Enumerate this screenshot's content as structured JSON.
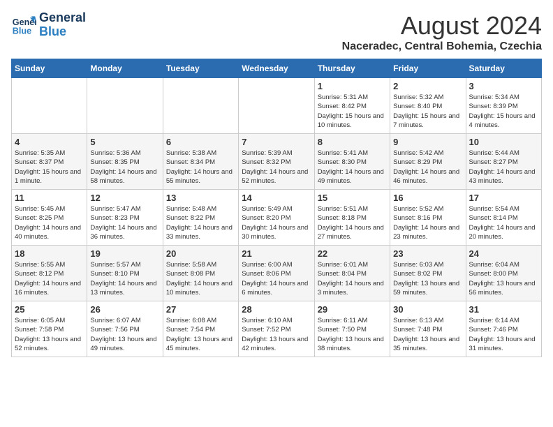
{
  "logo": {
    "line1": "General",
    "line2": "Blue"
  },
  "title": "August 2024",
  "location": "Naceradec, Central Bohemia, Czechia",
  "days_of_week": [
    "Sunday",
    "Monday",
    "Tuesday",
    "Wednesday",
    "Thursday",
    "Friday",
    "Saturday"
  ],
  "weeks": [
    [
      {
        "day": "",
        "info": ""
      },
      {
        "day": "",
        "info": ""
      },
      {
        "day": "",
        "info": ""
      },
      {
        "day": "",
        "info": ""
      },
      {
        "day": "1",
        "info": "Sunrise: 5:31 AM\nSunset: 8:42 PM\nDaylight: 15 hours\nand 10 minutes."
      },
      {
        "day": "2",
        "info": "Sunrise: 5:32 AM\nSunset: 8:40 PM\nDaylight: 15 hours\nand 7 minutes."
      },
      {
        "day": "3",
        "info": "Sunrise: 5:34 AM\nSunset: 8:39 PM\nDaylight: 15 hours\nand 4 minutes."
      }
    ],
    [
      {
        "day": "4",
        "info": "Sunrise: 5:35 AM\nSunset: 8:37 PM\nDaylight: 15 hours\nand 1 minute."
      },
      {
        "day": "5",
        "info": "Sunrise: 5:36 AM\nSunset: 8:35 PM\nDaylight: 14 hours\nand 58 minutes."
      },
      {
        "day": "6",
        "info": "Sunrise: 5:38 AM\nSunset: 8:34 PM\nDaylight: 14 hours\nand 55 minutes."
      },
      {
        "day": "7",
        "info": "Sunrise: 5:39 AM\nSunset: 8:32 PM\nDaylight: 14 hours\nand 52 minutes."
      },
      {
        "day": "8",
        "info": "Sunrise: 5:41 AM\nSunset: 8:30 PM\nDaylight: 14 hours\nand 49 minutes."
      },
      {
        "day": "9",
        "info": "Sunrise: 5:42 AM\nSunset: 8:29 PM\nDaylight: 14 hours\nand 46 minutes."
      },
      {
        "day": "10",
        "info": "Sunrise: 5:44 AM\nSunset: 8:27 PM\nDaylight: 14 hours\nand 43 minutes."
      }
    ],
    [
      {
        "day": "11",
        "info": "Sunrise: 5:45 AM\nSunset: 8:25 PM\nDaylight: 14 hours\nand 40 minutes."
      },
      {
        "day": "12",
        "info": "Sunrise: 5:47 AM\nSunset: 8:23 PM\nDaylight: 14 hours\nand 36 minutes."
      },
      {
        "day": "13",
        "info": "Sunrise: 5:48 AM\nSunset: 8:22 PM\nDaylight: 14 hours\nand 33 minutes."
      },
      {
        "day": "14",
        "info": "Sunrise: 5:49 AM\nSunset: 8:20 PM\nDaylight: 14 hours\nand 30 minutes."
      },
      {
        "day": "15",
        "info": "Sunrise: 5:51 AM\nSunset: 8:18 PM\nDaylight: 14 hours\nand 27 minutes."
      },
      {
        "day": "16",
        "info": "Sunrise: 5:52 AM\nSunset: 8:16 PM\nDaylight: 14 hours\nand 23 minutes."
      },
      {
        "day": "17",
        "info": "Sunrise: 5:54 AM\nSunset: 8:14 PM\nDaylight: 14 hours\nand 20 minutes."
      }
    ],
    [
      {
        "day": "18",
        "info": "Sunrise: 5:55 AM\nSunset: 8:12 PM\nDaylight: 14 hours\nand 16 minutes."
      },
      {
        "day": "19",
        "info": "Sunrise: 5:57 AM\nSunset: 8:10 PM\nDaylight: 14 hours\nand 13 minutes."
      },
      {
        "day": "20",
        "info": "Sunrise: 5:58 AM\nSunset: 8:08 PM\nDaylight: 14 hours\nand 10 minutes."
      },
      {
        "day": "21",
        "info": "Sunrise: 6:00 AM\nSunset: 8:06 PM\nDaylight: 14 hours\nand 6 minutes."
      },
      {
        "day": "22",
        "info": "Sunrise: 6:01 AM\nSunset: 8:04 PM\nDaylight: 14 hours\nand 3 minutes."
      },
      {
        "day": "23",
        "info": "Sunrise: 6:03 AM\nSunset: 8:02 PM\nDaylight: 13 hours\nand 59 minutes."
      },
      {
        "day": "24",
        "info": "Sunrise: 6:04 AM\nSunset: 8:00 PM\nDaylight: 13 hours\nand 56 minutes."
      }
    ],
    [
      {
        "day": "25",
        "info": "Sunrise: 6:05 AM\nSunset: 7:58 PM\nDaylight: 13 hours\nand 52 minutes."
      },
      {
        "day": "26",
        "info": "Sunrise: 6:07 AM\nSunset: 7:56 PM\nDaylight: 13 hours\nand 49 minutes."
      },
      {
        "day": "27",
        "info": "Sunrise: 6:08 AM\nSunset: 7:54 PM\nDaylight: 13 hours\nand 45 minutes."
      },
      {
        "day": "28",
        "info": "Sunrise: 6:10 AM\nSunset: 7:52 PM\nDaylight: 13 hours\nand 42 minutes."
      },
      {
        "day": "29",
        "info": "Sunrise: 6:11 AM\nSunset: 7:50 PM\nDaylight: 13 hours\nand 38 minutes."
      },
      {
        "day": "30",
        "info": "Sunrise: 6:13 AM\nSunset: 7:48 PM\nDaylight: 13 hours\nand 35 minutes."
      },
      {
        "day": "31",
        "info": "Sunrise: 6:14 AM\nSunset: 7:46 PM\nDaylight: 13 hours\nand 31 minutes."
      }
    ]
  ]
}
